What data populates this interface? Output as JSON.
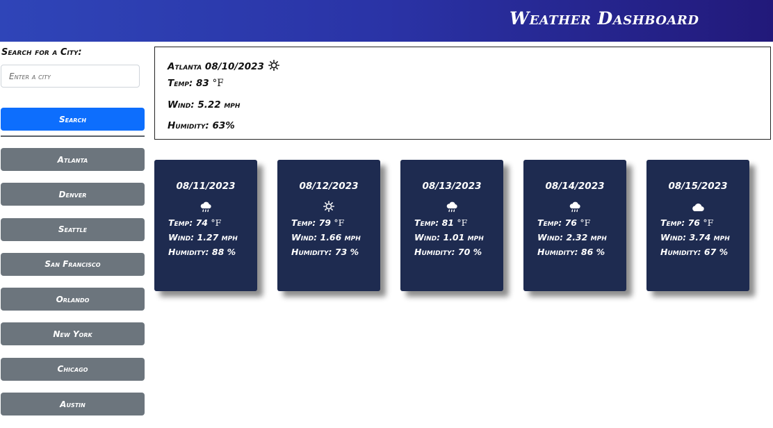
{
  "header": {
    "title": "Weather Dashboard"
  },
  "sidebar": {
    "search_label": "Search for a City:",
    "search_placeholder": "Enter a city",
    "search_button": "Search",
    "cities": [
      "Atlanta",
      "Denver",
      "Seattle",
      "San Francisco",
      "Orlando",
      "New York",
      "Chicago",
      "Austin"
    ]
  },
  "current": {
    "title": "Atlanta 08/10/2023",
    "icon": "sun-icon",
    "temp_label": "Temp:",
    "temp_value": "83",
    "temp_unit": "°F",
    "wind": "Wind: 5.22 mph",
    "humidity": "Humidity: 63%"
  },
  "forecast": [
    {
      "date": "08/11/2023",
      "icon": "rain-cloud-icon",
      "temp_label": "Temp:",
      "temp_value": "74",
      "temp_unit": "°F",
      "wind": "Wind: 1.27 mph",
      "humidity": "Humidity: 88 %"
    },
    {
      "date": "08/12/2023",
      "icon": "sun-icon",
      "temp_label": "Temp:",
      "temp_value": "79",
      "temp_unit": "°F",
      "wind": "Wind: 1.66 mph",
      "humidity": "Humidity: 73 %"
    },
    {
      "date": "08/13/2023",
      "icon": "rain-cloud-icon",
      "temp_label": "Temp:",
      "temp_value": "81",
      "temp_unit": "°F",
      "wind": "Wind: 1.01 mph",
      "humidity": "Humidity: 70 %"
    },
    {
      "date": "08/14/2023",
      "icon": "rain-cloud-icon",
      "temp_label": "Temp:",
      "temp_value": "76",
      "temp_unit": "°F",
      "wind": "Wind: 2.32 mph",
      "humidity": "Humidity: 86 %"
    },
    {
      "date": "08/15/2023",
      "icon": "cloud-icon",
      "temp_label": "Temp:",
      "temp_value": "76",
      "temp_unit": "°F",
      "wind": "Wind: 3.74 mph",
      "humidity": "Humidity: 67 %"
    }
  ],
  "colors": {
    "header_gradient_start": "#2f45b8",
    "header_gradient_end": "#22197a",
    "primary_button": "#0d6efd",
    "city_button": "#6c757d",
    "forecast_card": "#1e2b50"
  }
}
